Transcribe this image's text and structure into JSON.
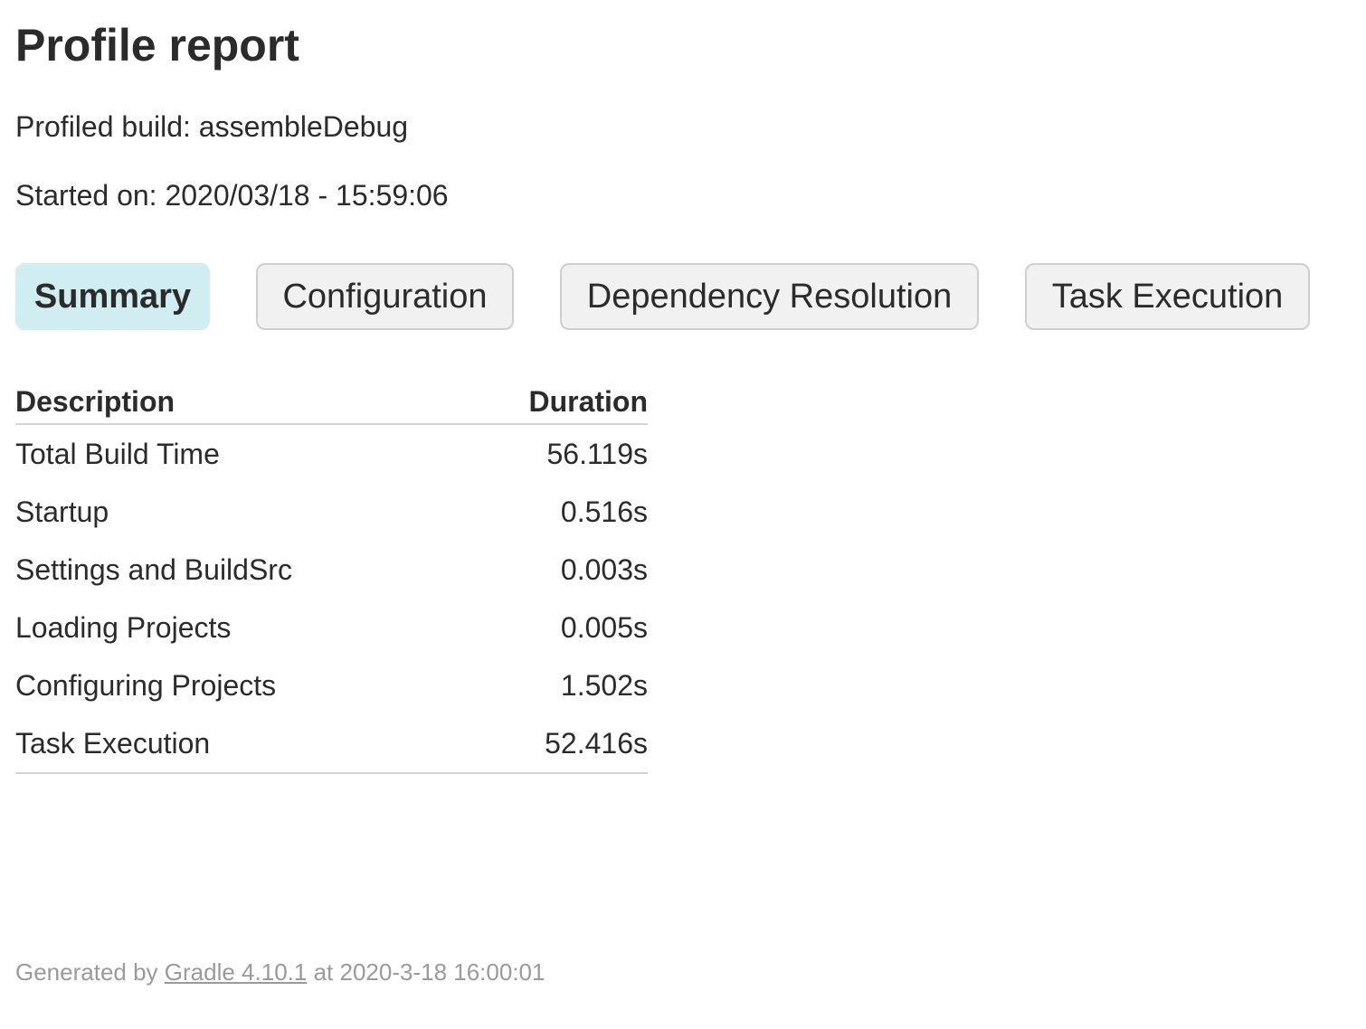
{
  "header": {
    "title": "Profile report",
    "build_label": "Profiled build:",
    "build_value": "assembleDebug",
    "started_label": "Started on:",
    "started_value": "2020/03/18 - 15:59:06"
  },
  "tabs": [
    {
      "label": "Summary",
      "active": true
    },
    {
      "label": "Configuration",
      "active": false
    },
    {
      "label": "Dependency Resolution",
      "active": false
    },
    {
      "label": "Task Execution",
      "active": false
    }
  ],
  "table": {
    "columns": {
      "description": "Description",
      "duration": "Duration"
    },
    "rows": [
      {
        "description": "Total Build Time",
        "duration": "56.119s"
      },
      {
        "description": "Startup",
        "duration": "0.516s"
      },
      {
        "description": "Settings and BuildSrc",
        "duration": "0.003s"
      },
      {
        "description": "Loading Projects",
        "duration": "0.005s"
      },
      {
        "description": "Configuring Projects",
        "duration": "1.502s"
      },
      {
        "description": "Task Execution",
        "duration": "52.416s"
      }
    ]
  },
  "footer": {
    "prefix": "Generated by",
    "link_text": "Gradle 4.10.1",
    "suffix": "at 2020-3-18 16:00:01"
  },
  "colors": {
    "active_tab_bg": "#d0eef2",
    "inactive_tab_bg": "#f1f1f1",
    "footer_text": "#9a9a9a"
  }
}
